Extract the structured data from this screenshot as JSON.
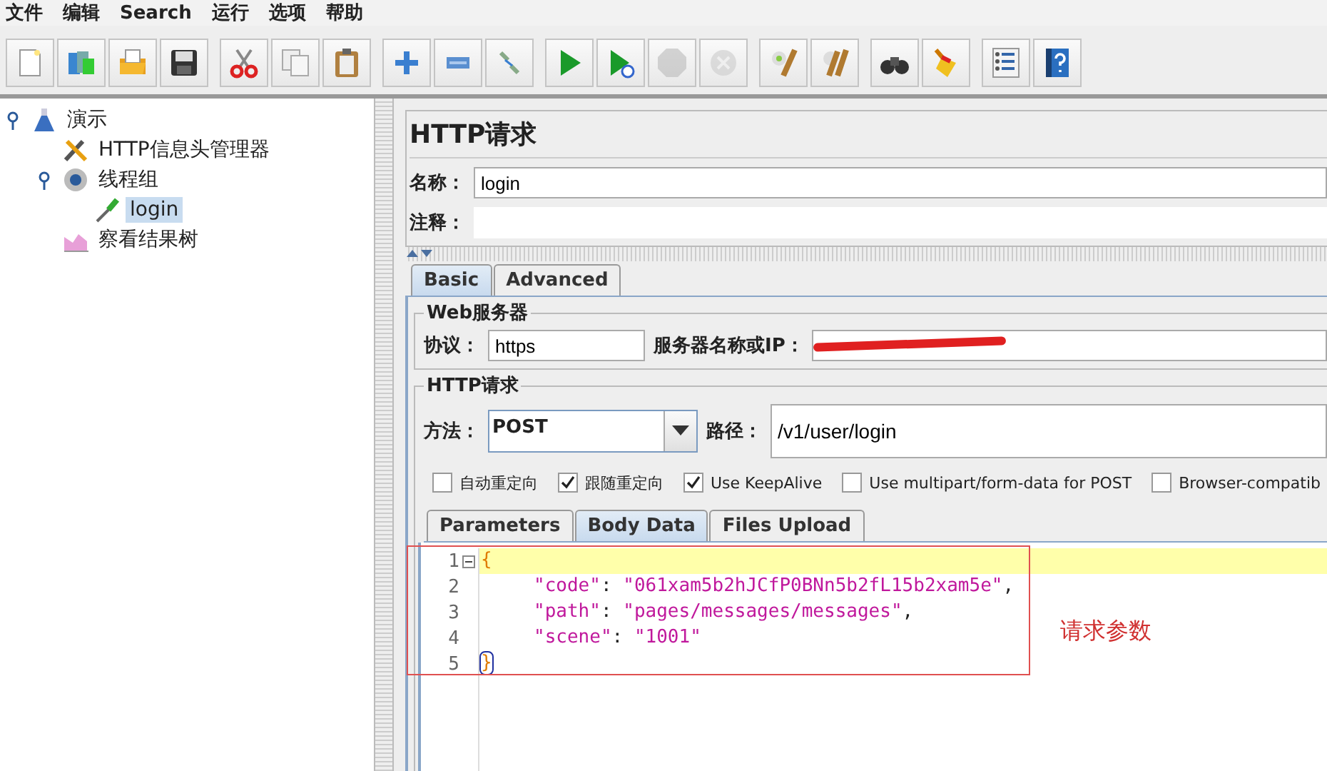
{
  "menu": [
    "文件",
    "编辑",
    "Search",
    "运行",
    "选项",
    "帮助"
  ],
  "toolbar": [
    {
      "icons": [
        {
          "kind": "new",
          "disabled": false
        },
        {
          "kind": "templates",
          "disabled": false
        },
        {
          "kind": "open",
          "disabled": false
        },
        {
          "kind": "save",
          "disabled": false
        }
      ]
    },
    {
      "icons": [
        {
          "kind": "cut",
          "disabled": false
        },
        {
          "kind": "copy",
          "disabled": false
        },
        {
          "kind": "paste",
          "disabled": false
        }
      ]
    },
    {
      "icons": [
        {
          "kind": "expand",
          "disabled": false
        },
        {
          "kind": "collapse",
          "disabled": false
        },
        {
          "kind": "toggle",
          "disabled": false
        }
      ]
    },
    {
      "icons": [
        {
          "kind": "start",
          "disabled": false
        },
        {
          "kind": "start-no-pause",
          "disabled": false
        },
        {
          "kind": "stop",
          "disabled": true
        },
        {
          "kind": "shutdown",
          "disabled": true
        }
      ]
    },
    {
      "icons": [
        {
          "kind": "clear",
          "disabled": false
        },
        {
          "kind": "clear-all",
          "disabled": false
        }
      ]
    },
    {
      "icons": [
        {
          "kind": "search",
          "disabled": false
        },
        {
          "kind": "reset-search",
          "disabled": false
        }
      ]
    },
    {
      "icons": [
        {
          "kind": "functions",
          "disabled": false
        },
        {
          "kind": "help",
          "disabled": false
        }
      ]
    }
  ],
  "tree": {
    "label": "演示",
    "kind": "plan",
    "expanded": true,
    "selected": false,
    "children": [
      {
        "label": "HTTP信息头管理器",
        "kind": "config",
        "selected": false
      },
      {
        "label": "线程组",
        "kind": "threads",
        "expanded": true,
        "selected": false,
        "children": [
          {
            "label": "login",
            "kind": "sampler",
            "selected": true
          }
        ]
      },
      {
        "label": "察看结果树",
        "kind": "listener",
        "selected": false
      }
    ]
  },
  "panel": {
    "title": "HTTP请求",
    "name": {
      "label": "名称：",
      "value": "login"
    },
    "comment": {
      "label": "注释："
    },
    "tabs": [
      {
        "label": "Basic",
        "selected": true
      },
      {
        "label": "Advanced",
        "selected": false
      }
    ],
    "web_server": {
      "title": "Web服务器",
      "protocol": {
        "label": "协议：",
        "value": "https"
      },
      "server": {
        "label": "服务器名称或IP：",
        "redacted": true
      }
    },
    "http_request": {
      "title": "HTTP请求",
      "method": {
        "label": "方法：",
        "value": "POST"
      },
      "path": {
        "label": "路径：",
        "value": "/v1/user/login"
      },
      "options": [
        {
          "label": "自动重定向",
          "checked": false
        },
        {
          "label": "跟随重定向",
          "checked": true
        },
        {
          "label": "Use KeepAlive",
          "checked": true
        },
        {
          "label": "Use multipart/form-data for POST",
          "checked": false
        },
        {
          "label": "Browser-compatib",
          "checked": false
        }
      ]
    },
    "sub_tabs": [
      {
        "label": "Parameters",
        "selected": false
      },
      {
        "label": "Body Data",
        "selected": true
      },
      {
        "label": "Files Upload",
        "selected": false
      }
    ],
    "editor": {
      "lines": [
        {
          "number": "1",
          "kind": "open",
          "current": true,
          "fold": true,
          "tokens": [
            {
              "text": "{",
              "kind": "brace"
            }
          ]
        },
        {
          "number": "2",
          "kind": "member",
          "current": false,
          "fold": false,
          "tokens": [
            {
              "text": "\"code\"",
              "kind": "string"
            },
            {
              "text": ": ",
              "kind": "punct"
            },
            {
              "text": "\"061xam5b2hJCfP0BNn5b2fL15b2xam5e\"",
              "kind": "string"
            },
            {
              "text": ",",
              "kind": "punct"
            }
          ]
        },
        {
          "number": "3",
          "kind": "member",
          "current": false,
          "fold": false,
          "tokens": [
            {
              "text": "\"path\"",
              "kind": "string"
            },
            {
              "text": ": ",
              "kind": "punct"
            },
            {
              "text": "\"pages/messages/messages\"",
              "kind": "string"
            },
            {
              "text": ",",
              "kind": "punct"
            }
          ]
        },
        {
          "number": "4",
          "kind": "member",
          "current": false,
          "fold": false,
          "tokens": [
            {
              "text": "\"scene\"",
              "kind": "string"
            },
            {
              "text": ": ",
              "kind": "punct"
            },
            {
              "text": "\"1001\"",
              "kind": "string"
            }
          ]
        },
        {
          "number": "5",
          "kind": "close",
          "current": false,
          "fold": false,
          "tokens": [
            {
              "text": "}",
              "kind": "brace-matched"
            }
          ]
        }
      ]
    },
    "annotation": {
      "text": "请求参数"
    }
  }
}
